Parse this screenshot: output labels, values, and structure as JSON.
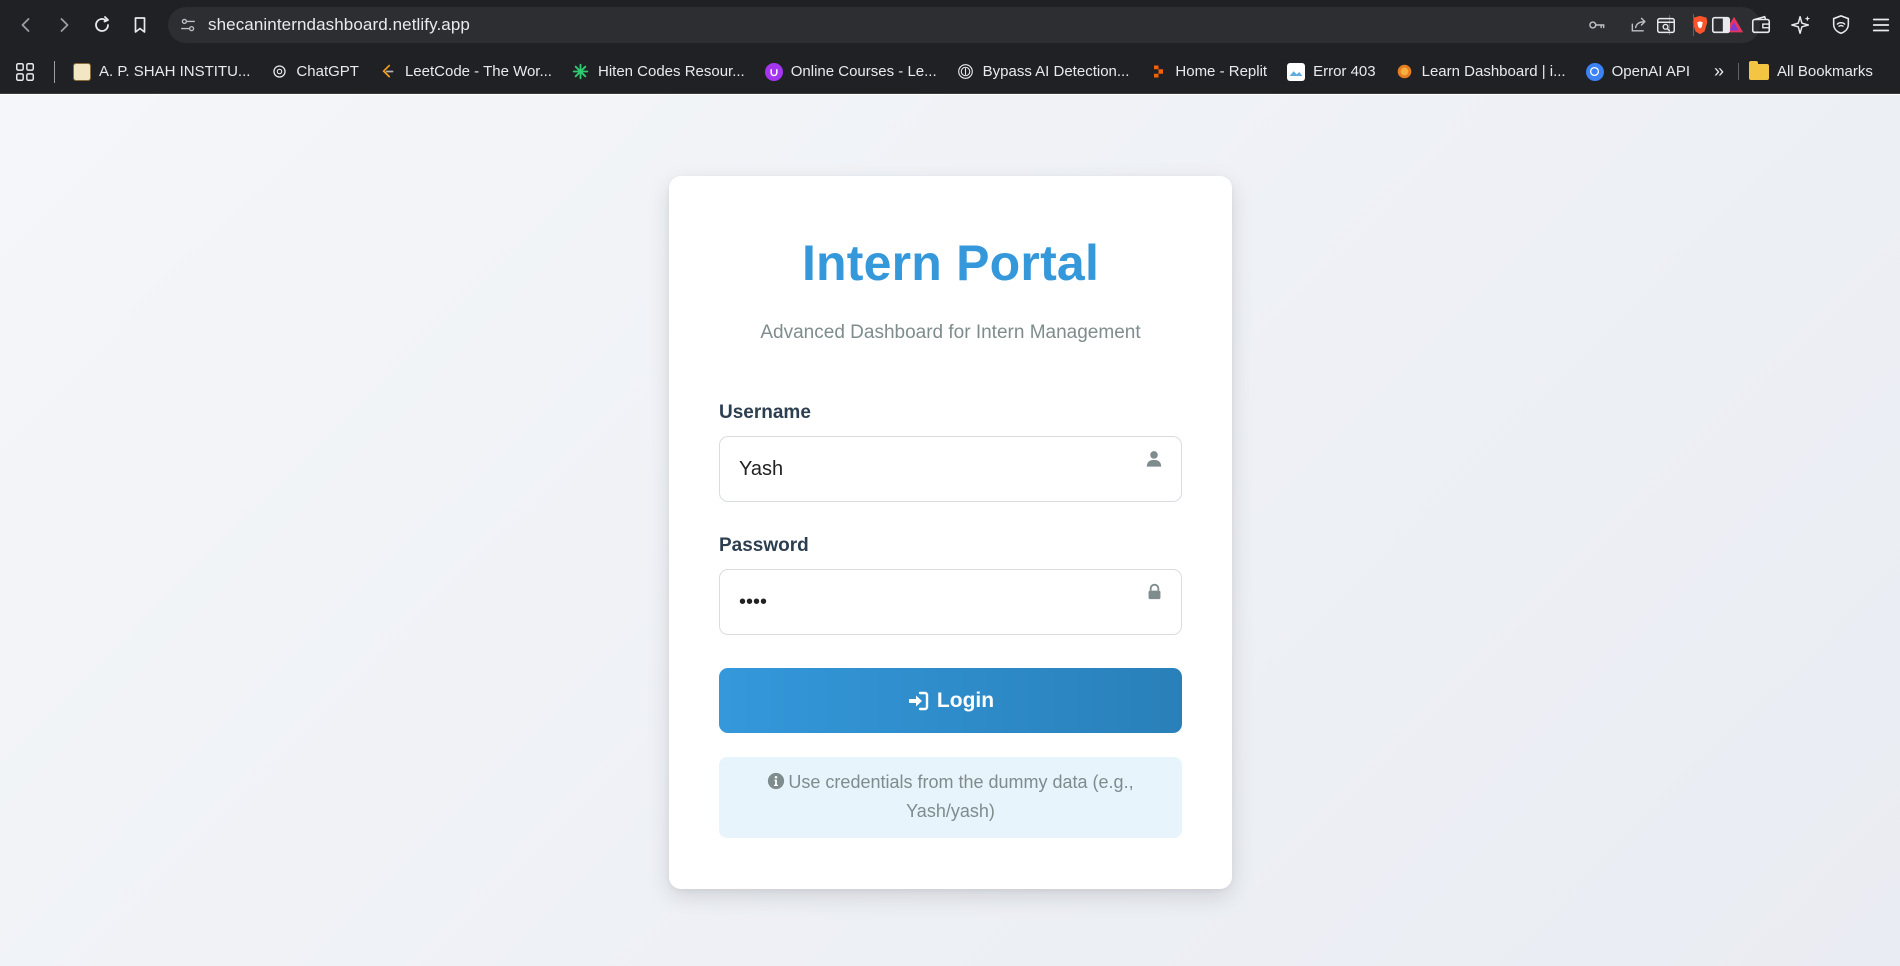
{
  "browser": {
    "url": "shecaninterndashboard.netlify.app",
    "bookmarks": [
      {
        "label": "A. P. SHAH INSTITU...",
        "icon": "institute-logo-icon",
        "color": "#8a6d3b"
      },
      {
        "label": "ChatGPT",
        "icon": "chatgpt-icon",
        "color": "#e8eaed"
      },
      {
        "label": "LeetCode - The Wor...",
        "icon": "leetcode-icon",
        "color": "#f89f1b"
      },
      {
        "label": "Hiten Codes Resour...",
        "icon": "asterisk-icon",
        "color": "#2ecc71"
      },
      {
        "label": "Online Courses - Le...",
        "icon": "udemy-icon",
        "color": "#a435f0"
      },
      {
        "label": "Bypass AI Detection...",
        "icon": "fingerprint-icon",
        "color": "#e8eaed"
      },
      {
        "label": "Home - Replit",
        "icon": "replit-icon",
        "color": "#f26207"
      },
      {
        "label": "Error 403",
        "icon": "image-icon",
        "color": "#5dade2"
      },
      {
        "label": "Learn Dashboard | i...",
        "icon": "learn-icon",
        "color": "#e67e22"
      },
      {
        "label": "OpenAI API",
        "icon": "openai-icon",
        "color": "#3b82f6"
      }
    ],
    "more_label": "»",
    "all_bookmarks_label": "All Bookmarks"
  },
  "login": {
    "title": "Intern Portal",
    "subtitle": "Advanced Dashboard for Intern Management",
    "username_label": "Username",
    "username_value": "Yash",
    "password_label": "Password",
    "password_value": "yash",
    "button_label": "Login",
    "hint": "Use credentials from the dummy data (e.g., Yash/yash)"
  },
  "colors": {
    "accent": "#3498db",
    "accent_dark": "#2980b9",
    "hint_bg": "#e8f4fb",
    "text_dark": "#2c3e50",
    "text_muted": "#7f8c8d"
  }
}
